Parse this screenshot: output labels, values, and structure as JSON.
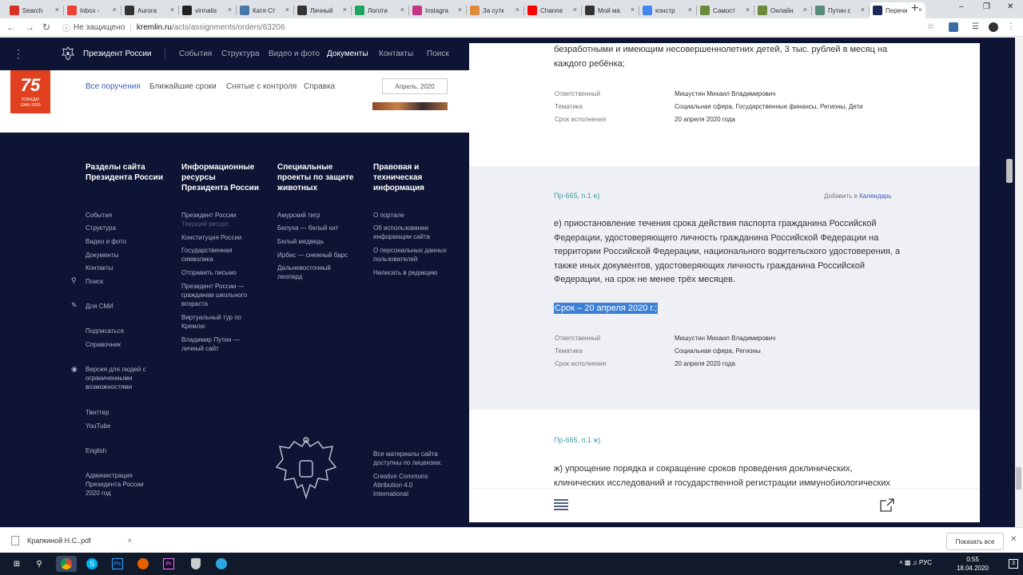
{
  "browser": {
    "tabs": [
      {
        "title": "Search",
        "icon_color": "#d93025",
        "icon": "search-favicon"
      },
      {
        "title": "Inbox -",
        "icon_color": "#ea4335",
        "icon": "gmail-icon"
      },
      {
        "title": "Aurora",
        "icon_color": "#333333",
        "icon": "aurora-icon"
      },
      {
        "title": "virmalis",
        "icon_color": "#222222",
        "icon": "vimeo-icon"
      },
      {
        "title": "Катя Ст",
        "icon_color": "#4a76a8",
        "icon": "vk-icon"
      },
      {
        "title": "Личный",
        "icon_color": "#333333",
        "icon": "pen-icon"
      },
      {
        "title": "Логоти",
        "icon_color": "#1fa463",
        "icon": "drive-icon"
      },
      {
        "title": "Instagra",
        "icon_color": "#c13584",
        "icon": "instagram-icon"
      },
      {
        "title": "За сутк",
        "icon_color": "#e08a3c",
        "icon": "globe-icon"
      },
      {
        "title": "Channe",
        "icon_color": "#ff0000",
        "icon": "youtube-icon"
      },
      {
        "title": "Мой ма",
        "icon_color": "#333333",
        "icon": "pen-icon"
      },
      {
        "title": "констр",
        "icon_color": "#4285f4",
        "icon": "google-icon"
      },
      {
        "title": "Самост",
        "icon_color": "#6a8a3a",
        "icon": "bookmark-icon"
      },
      {
        "title": "Онлайн",
        "icon_color": "#6a8a3a",
        "icon": "bookmark-icon"
      },
      {
        "title": "Путин с",
        "icon_color": "#5a8a7a",
        "icon": "page-icon"
      },
      {
        "title": "Перечи",
        "icon_color": "#1a2a5a",
        "icon": "kremlin-icon"
      }
    ],
    "new_tab": "+",
    "url_security": "Не защищено",
    "url_host": "kremlin.ru",
    "url_path": "/acts/assignments/orders/63206"
  },
  "site": {
    "title": "Президент России",
    "nav": [
      "События",
      "Структура",
      "Видео и фото",
      "Документы",
      "Контакты",
      "Поиск"
    ],
    "nav_current": 3,
    "logo_number": "75",
    "logo_text": "ПОБЕДА!",
    "logo_years": "1945–2020",
    "subtabs": [
      "Все поручения",
      "Ближайшие сроки",
      "Снятые с контроля",
      "Справка"
    ],
    "month": "Апрель, 2020"
  },
  "footer": {
    "col1_title": "Разделы сайта Президента России",
    "col1_links": [
      "События",
      "Структура",
      "Видео и фото",
      "Документы",
      "Контакты"
    ],
    "search": "Поиск",
    "media": "Для СМИ",
    "subscribe": "Подписаться",
    "reference": "Справочник",
    "accessible": "Версия для людей с ограниченными возможностями",
    "twitter": "Твиттер",
    "youtube": "YouTube",
    "english": "English",
    "admin": "Администрация Президента России 2020 год",
    "col2_title": "Информационные ресурсы Президента России",
    "col2_links": [
      "Президент России",
      "Текущий ресурс",
      "Конституция России",
      "Государственная символика",
      "Отправить письмо",
      "Президент России — гражданам школьного возраста",
      "Виртуальный тур по Кремлю",
      "Владимир Путин — личный сайт"
    ],
    "col3_title": "Специальные проекты по защите животных",
    "col3_links": [
      "Амурский тигр",
      "Белуха — белый кит",
      "Белый медведь",
      "Ирбис — снежный барс",
      "Дальневосточный леопард"
    ],
    "col4_title": "Правовая и техническая информация",
    "col4_links": [
      "О портале",
      "Об использовании информации сайта",
      "О персональных данных пользователей",
      "Написать в редакцию"
    ],
    "license": "Все материалы сайта доступны по лицензии:",
    "license_name": "Creative Commons Attribution 4.0 International"
  },
  "panel": {
    "top_text": "безработными и имеющим несовершеннолетних детей, 3 тыс. рублей в месяц на каждого ребёнка;",
    "meta_labels": [
      "Ответственный",
      "Тематика",
      "Срок исполнения"
    ],
    "item0_meta": [
      "Мишустин Михаил Владимирович",
      "Социальная сфера, Государственные финансы, Регионы, Дети",
      "20 апреля 2020 года"
    ],
    "item1_code": "Пр-665, п.1 е)",
    "add_calendar": "Добавить в",
    "calendar": "Календарь",
    "item1_text": "е) приостановление течения срока действия паспорта гражданина Российской Федерации, удостоверяющего личность гражданина Российской Федерации на территории Российской Федерации, национального водительского удостоверения, а также иных документов, удостоверяющих личность гражданина Российской Федерации, на срок не менее трёх месяцев.",
    "item1_deadline": "Срок – 20 апреля 2020 г.;",
    "item1_meta": [
      "Мишустин Михаил Владимирович",
      "Социальная сфера, Регионы",
      "20 апреля 2020 года"
    ],
    "item2_code": "Пр-665, п.1 ж)",
    "item2_text": "ж) упрощение порядка и сокращение сроков проведения доклинических, клинических исследований и государственной регистрации иммунобиологических"
  },
  "downloads": {
    "file": "Крапкиной Н.С..pdf",
    "show_all": "Показать все"
  },
  "taskbar": {
    "lang": "РУС",
    "time": "0:55",
    "date": "18.04.2020",
    "notifications": "3"
  }
}
